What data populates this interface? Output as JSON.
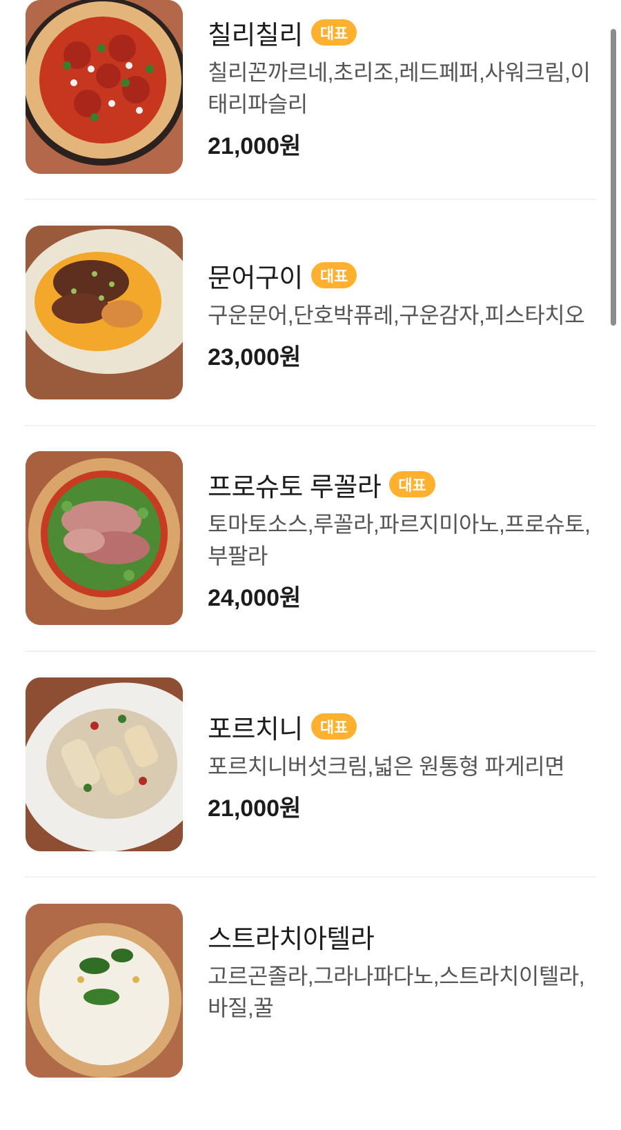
{
  "badge_label": "대표",
  "colors": {
    "badge": "#ffb02e",
    "divider": "#f1f1f1"
  },
  "menu_items": [
    {
      "name": "칠리칠리",
      "badge": true,
      "desc": "칠리꼰까르네,초리조,레드페퍼,사워크림,이태리파슬리",
      "price": "21,000원",
      "image": "pizza-pepperoni-icon"
    },
    {
      "name": "문어구이",
      "badge": true,
      "desc": "구운문어,단호박퓨레,구운감자,피스타치오",
      "price": "23,000원",
      "image": "grilled-octopus-icon"
    },
    {
      "name": "프로슈토 루꼴라",
      "badge": true,
      "desc": "토마토소스,루꼴라,파르지미아노,프로슈토,부팔라",
      "price": "24,000원",
      "image": "pizza-prosciutto-icon"
    },
    {
      "name": "포르치니",
      "badge": true,
      "desc": "포르치니버섯크림,넓은 원통형 파게리면",
      "price": "21,000원",
      "image": "porcini-pasta-icon"
    },
    {
      "name": "스트라치아텔라",
      "badge": false,
      "desc": "고르곤졸라,그라나파다노,스트라치이텔라,바질,꿀",
      "price": "",
      "image": "pizza-white-icon"
    }
  ]
}
